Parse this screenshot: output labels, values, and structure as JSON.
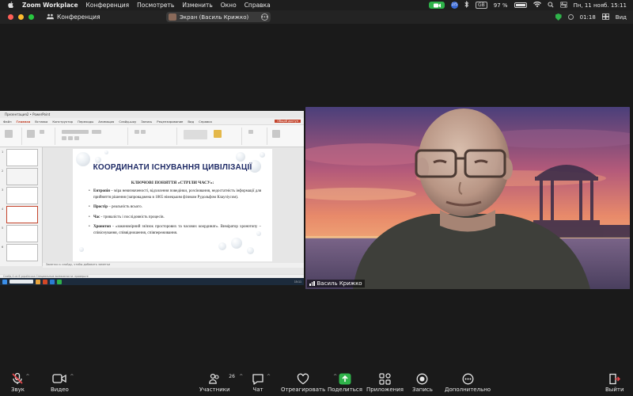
{
  "menubar": {
    "app_name": "Zoom Workplace",
    "menus": [
      "Конференция",
      "Посмотреть",
      "Изменить",
      "Окно",
      "Справка"
    ],
    "lang_badge": "GB",
    "battery": "97 %",
    "date_time": "Пн, 11 нояб.  15:11",
    "circle_badge": "2/5"
  },
  "titlebar": {
    "meeting_label": "Конференция",
    "share_label": "Экран (Василь Крижко)",
    "timer": "01:18",
    "view_label": "Вид"
  },
  "presentation": {
    "window_title": "Презентация2  •  PowerPoint",
    "tabs": [
      "Файл",
      "Главная",
      "Вставка",
      "Конструктор",
      "Переходы",
      "Анимация",
      "Слайд-шоу",
      "Запись",
      "Рецензирование",
      "Вид",
      "Справка"
    ],
    "active_tab": "Главная",
    "share_button": "Общий доступ",
    "slide_numbers": [
      "1",
      "2",
      "3",
      "4",
      "5",
      "6"
    ],
    "slide_title": "КООРДИНАТИ ІСНУВАННЯ ЦИВІЛІЗАЦІЇ",
    "slide_subtitle": "КЛЮЧОВІ ПОНЯТТЯ «СТРІЛИ ЧАСУ»:",
    "bullets": [
      {
        "term": "Ентропія",
        "text": " – міра невизначеності, відхилення поведінки, розсіювання, недостатність інформації для прийняття рішення (запроваджена в 1865 німецьким фізиком Рудольфом Клаузіусом)."
      },
      {
        "term": "Простір",
        "text": " – реальність всього."
      },
      {
        "term": "Час",
        "text": " - тривалість і послідовність процесів."
      },
      {
        "term": "Хронотоп",
        "text": " - «закономірний зв'язок просторових та часових координат». Виміратор хронотопу – співіснування, співвідношення, співпереживання."
      }
    ],
    "notes_placeholder": "Заметки к слайду, чтобы добавить заметки",
    "status_text": "Слайд 4 из 6    українська    Специальные возможности: проверьте",
    "taskbar_time": "15:11"
  },
  "video": {
    "participant_name": "Василь Крижко"
  },
  "toolbar": {
    "mute_label": "Звук",
    "video_label": "Видео",
    "participants_label": "Участники",
    "participants_count": "26",
    "chat_label": "Чат",
    "react_label": "Отреагировать",
    "share_label": "Поделиться",
    "apps_label": "Приложения",
    "record_label": "Запись",
    "more_label": "Дополнительно",
    "leave_label": "Выйти"
  },
  "colors": {
    "accent_green": "#2fb24a",
    "mute_red": "#e5484d",
    "ppt_accent": "#c4432b",
    "slide_title": "#1f2b66"
  }
}
